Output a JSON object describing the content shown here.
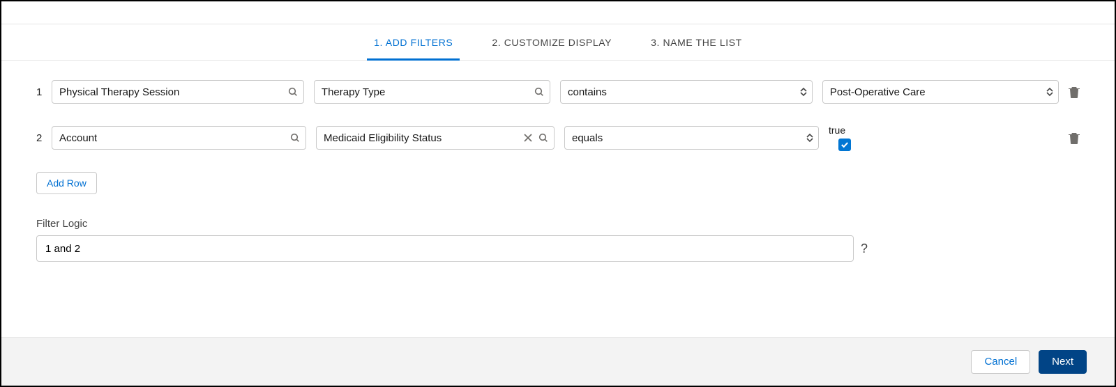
{
  "tabs": {
    "t1": "1. ADD FILTERS",
    "t2": "2. CUSTOMIZE DISPLAY",
    "t3": "3. NAME THE LIST"
  },
  "rows": [
    {
      "num": "1",
      "object": "Physical Therapy Session",
      "field": "Therapy Type",
      "field_clearable": false,
      "operator": "contains",
      "value_type": "select",
      "value": "Post-Operative Care"
    },
    {
      "num": "2",
      "object": "Account",
      "field": "Medicaid Eligibility Status",
      "field_clearable": true,
      "operator": "equals",
      "value_type": "checkbox",
      "value_label": "true",
      "value_checked": true
    }
  ],
  "buttons": {
    "add_row": "Add Row",
    "cancel": "Cancel",
    "next": "Next"
  },
  "filter_logic": {
    "label": "Filter Logic",
    "value": "1 and 2",
    "help": "?"
  }
}
